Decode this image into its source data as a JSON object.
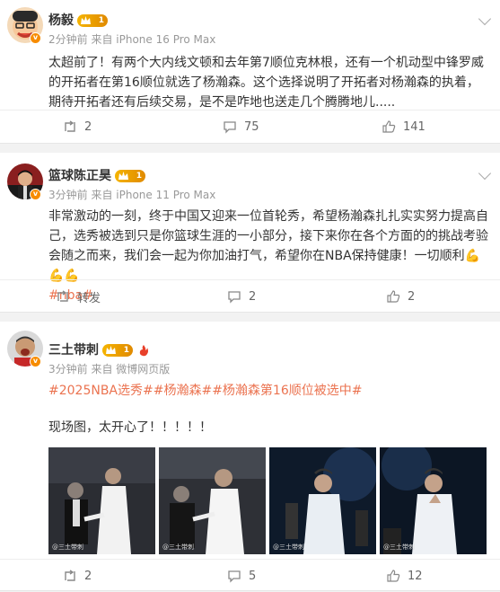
{
  "posts": [
    {
      "name": "杨毅",
      "level": "1",
      "time": "2分钟前",
      "source": "来自 iPhone 16 Pro Max",
      "text": "太超前了！有两个大内线文顿和去年第7顺位克林根，还有一个机动型中锋罗威的开拓者在第16顺位就选了杨瀚森。这个选择说明了开拓者对杨瀚森的执着，期待开拓者还有后续交易，是不是咋地也送走几个腾腾地儿.....",
      "repost": "2",
      "comments": "75",
      "likes": "141"
    },
    {
      "name": "篮球陈正昊",
      "level": "1",
      "time": "3分钟前",
      "source": "来自 iPhone 11 Pro Max",
      "text": "非常激动的一刻，终于中国又迎来一位首轮秀，希望杨瀚森扎扎实实努力提高自己，选秀被选到只是你篮球生涯的一小部分，接下来你在各个方面的的挑战考验会随之而来，我们会一起为你加油打气，希望你在NBA保持健康！一切顺利",
      "emoji": "💪💪💪",
      "tag": "#nba#",
      "repost": "转发",
      "comments": "2",
      "likes": "2"
    },
    {
      "name": "三土带刺",
      "level": "1",
      "time": "3分钟前",
      "source": "来自 微博网页版",
      "tags": "#2025NBA选秀##杨瀚森##杨瀚森第16顺位被选中#",
      "text": "现场图，太开心了！！！！！",
      "watermark": "@三土带刺",
      "repost": "2",
      "comments": "5",
      "likes": "12"
    }
  ],
  "colors": {
    "accent": "#eb7350",
    "level": "#f5a623",
    "verified": "#f78c00"
  }
}
